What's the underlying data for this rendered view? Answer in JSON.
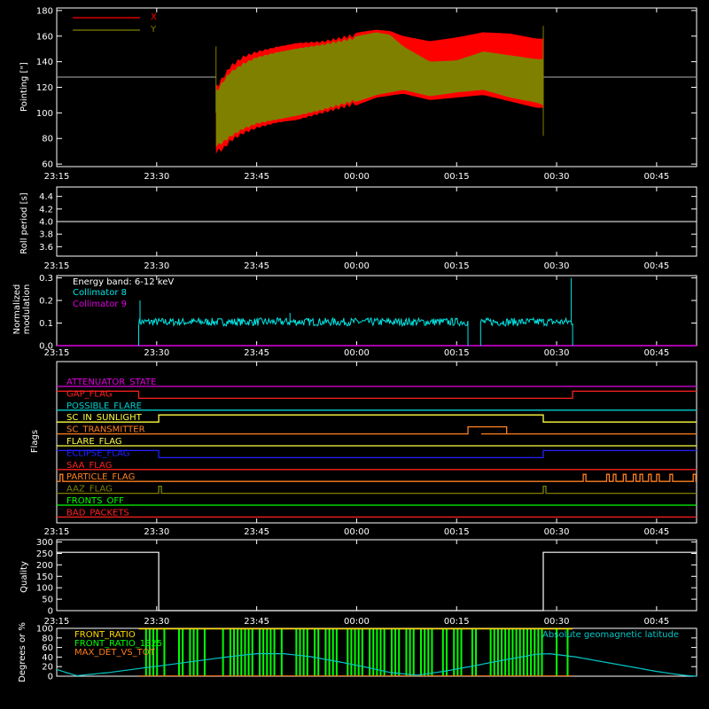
{
  "colors": {
    "bg": "#000000",
    "axes": "#ffffff",
    "x_pointing": "#ff0000",
    "y_pointing": "#808000",
    "collimator8": "#00e5e5",
    "collimator9": "#e000e0",
    "front_ratio": "#ffd800",
    "front_ratio_2": "#00ff00",
    "max_det": "#ff7a1a",
    "geo_lat": "#00c8c8"
  },
  "time_ticks": [
    "23:15",
    "23:30",
    "23:45",
    "00:00",
    "00:15",
    "00:30",
    "00:45"
  ],
  "chart_data": [
    {
      "id": "pointing",
      "type": "area",
      "ylabel": "Pointing [\"]",
      "ylim": [
        58,
        182
      ],
      "yticks": [
        "60",
        "80",
        "100",
        "120",
        "140",
        "160",
        "180"
      ],
      "x_units": "minutes from 23:15",
      "data_span": [
        23.9,
        73.0
      ],
      "baseline": 128,
      "series": [
        {
          "name": "X",
          "color": "#ff0000",
          "max_envelope": {
            "x": [
              24,
              25,
              26,
              28,
              30,
              33,
              36,
              40,
              44,
              48,
              50,
              52,
              56,
              60,
              64,
              68,
              72,
              73
            ],
            "y": [
              122,
              130,
              138,
              146,
              150,
              154,
              157,
              158,
              162,
              165,
              164,
              160,
              156,
              159,
              163,
              162,
              158,
              158
            ]
          },
          "min_envelope": {
            "x": [
              24,
              25,
              26,
              28,
              30,
              33,
              36,
              40,
              44,
              48,
              52,
              56,
              60,
              64,
              68,
              72,
              73
            ],
            "y": [
              68,
              70,
              76,
              82,
              86,
              90,
              92,
              98,
              104,
              112,
              115,
              110,
              112,
              114,
              109,
              104,
              104
            ]
          }
        },
        {
          "name": "Y",
          "color": "#808000",
          "max_envelope": {
            "x": [
              24,
              25,
              26,
              28,
              30,
              33,
              36,
              40,
              44,
              48,
              50,
              52,
              56,
              60,
              64,
              68,
              72,
              73
            ],
            "y": [
              118,
              126,
              133,
              140,
              145,
              149,
              152,
              155,
              159,
              163,
              161,
              152,
              140,
              141,
              148,
              145,
              142,
              142
            ]
          },
          "min_envelope": {
            "x": [
              24,
              25,
              26,
              28,
              30,
              33,
              36,
              40,
              44,
              48,
              52,
              56,
              60,
              64,
              68,
              72,
              73
            ],
            "y": [
              73,
              76,
              80,
              86,
              90,
              93,
              96,
              101,
              107,
              114,
              118,
              113,
              116,
              118,
              112,
              108,
              106
            ]
          }
        }
      ]
    },
    {
      "id": "roll",
      "type": "line",
      "ylabel": "Roll period [s]",
      "ylim": [
        3.45,
        4.55
      ],
      "yticks": [
        "3.6",
        "3.8",
        "4.0",
        "4.2",
        "4.4"
      ],
      "series": [
        {
          "x": [
            0,
            96
          ],
          "y": [
            4.0,
            4.0
          ],
          "color": "#ffffff"
        }
      ]
    },
    {
      "id": "modulation",
      "type": "line",
      "ylabel_lines": [
        "Normalized",
        "modulation"
      ],
      "ylim": [
        0,
        0.31
      ],
      "yticks": [
        "0.0",
        "0.1",
        "0.2",
        "0.3"
      ],
      "annotation": "Energy band: 6-12 keV",
      "series": [
        {
          "name": "Collimator 8",
          "color": "#00e5e5",
          "segments": [
            {
              "x": [
                12.3,
                61.7
              ],
              "level": 0.105
            },
            {
              "x": [
                63.6,
                77.4
              ],
              "level": 0.105
            }
          ],
          "spikes": [
            {
              "x": 12.5,
              "y": 0.2
            },
            {
              "x": 35,
              "y": 0.145
            },
            {
              "x": 77.2,
              "y": 0.3
            }
          ]
        },
        {
          "name": "Collimator 9",
          "color": "#e000e0",
          "level": 0.0
        }
      ]
    },
    {
      "id": "flags",
      "type": "line",
      "ylabel": "Flags",
      "flags": [
        {
          "name": "ATTENUATOR_STATE",
          "color": "#e000e0",
          "steps": []
        },
        {
          "name": "GAP_FLAG",
          "color": "#ff2020",
          "steps": [
            {
              "x": [
                12.3,
                77.4
              ],
              "v": 0
            }
          ],
          "default": 1
        },
        {
          "name": "POSSIBLE_FLARE",
          "color": "#00d0d0",
          "steps": []
        },
        {
          "name": "SC_IN_SUNLIGHT",
          "color": "#ffff40",
          "steps": [
            {
              "x": [
                15.3,
                73.0
              ],
              "v": 1
            }
          ]
        },
        {
          "name": "SC_TRANSMITTER",
          "color": "#ff8020",
          "steps": [
            {
              "x": [
                61.7,
                67.5
              ],
              "v": 1
            },
            {
              "x": [
                63.7,
                64.4
              ],
              "v": 0
            }
          ]
        },
        {
          "name": "FLARE_FLAG",
          "color": "#ffff40",
          "steps": []
        },
        {
          "name": "ECLIPSE_FLAG",
          "color": "#2020ff",
          "steps": [
            {
              "x": [
                15.3,
                73.0
              ],
              "v": 0
            }
          ],
          "default": 1
        },
        {
          "name": "SAA_FLAG",
          "color": "#ff2020",
          "steps": []
        },
        {
          "name": "PARTICLE_FLAG",
          "color": "#ff8020",
          "pulses": [
            0.5,
            79.0,
            82.5,
            83.5,
            85.0,
            86.5,
            87.5,
            88.8,
            90.0,
            92.0,
            95.5
          ]
        },
        {
          "name": "AAZ_FLAG",
          "color": "#808000",
          "pulses": [
            15.3,
            73.0
          ]
        },
        {
          "name": "FRONTS_OFF",
          "color": "#00ff00",
          "steps": []
        },
        {
          "name": "BAD_PACKETS",
          "color": "#ff2020",
          "steps": []
        }
      ]
    },
    {
      "id": "quality",
      "type": "line",
      "ylabel": "Quality",
      "ylim": [
        0,
        310
      ],
      "yticks": [
        "0",
        "50",
        "100",
        "150",
        "200",
        "250",
        "300"
      ],
      "series": [
        {
          "x": [
            0,
            15.3,
            15.3,
            73.0,
            73.0,
            96
          ],
          "y": [
            255,
            255,
            0,
            0,
            255,
            255
          ],
          "color": "#ffffff"
        }
      ]
    },
    {
      "id": "latitude",
      "type": "line",
      "ylabel": "Degrees or %",
      "ylim": [
        0,
        100
      ],
      "yticks": [
        "0",
        "20",
        "40",
        "60",
        "80",
        "100"
      ],
      "legend_left": [
        "FRONT_RATIO",
        "FRONT_RATIO_1325",
        "MAX_DET_VS_TOT"
      ],
      "legend_right": "Absolute geomagnetic latitude",
      "bars_span": [
        12.3,
        77.4
      ],
      "series": [
        {
          "name": "Absolute geomagnetic latitude",
          "color": "#00c8c8",
          "x": [
            0,
            3,
            8,
            14,
            20,
            26,
            30,
            34,
            38,
            42,
            46,
            50,
            54,
            58,
            62,
            66,
            70,
            72,
            74,
            78,
            82,
            86,
            90,
            94,
            96
          ],
          "y": [
            14,
            1,
            8,
            19,
            30,
            41,
            47,
            47,
            41,
            31,
            20,
            8,
            2,
            10,
            20,
            31,
            41,
            46,
            47,
            40,
            30,
            20,
            10,
            2,
            0
          ]
        }
      ]
    }
  ]
}
